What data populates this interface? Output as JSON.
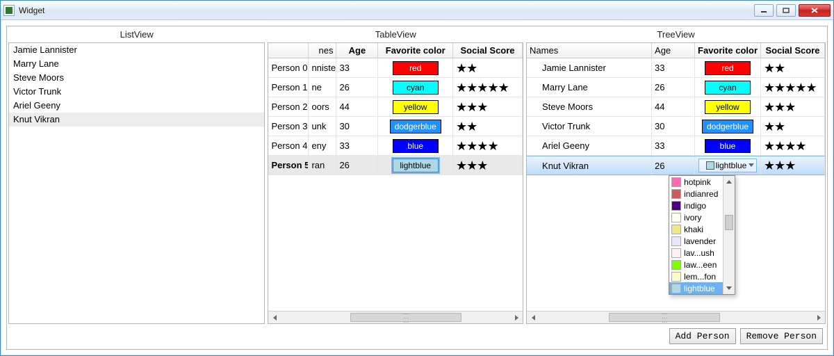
{
  "window": {
    "title": "Widget"
  },
  "listview": {
    "header": "ListView",
    "items": [
      {
        "name": "Jamie Lannister"
      },
      {
        "name": "Marry Lane"
      },
      {
        "name": "Steve Moors"
      },
      {
        "name": "Victor Trunk"
      },
      {
        "name": "Ariel Geeny"
      },
      {
        "name": "Knut Vikran",
        "selected": true
      }
    ]
  },
  "tableview": {
    "header": "TableView",
    "columns": {
      "names_partial": "nes",
      "age": "Age",
      "favorite": "Favorite color",
      "social": "Social Score"
    },
    "rows": [
      {
        "idx": "Person 0",
        "name_partial": "nnister",
        "age": "33",
        "color": "red",
        "color_hex": "#ff0000",
        "stars": 2
      },
      {
        "idx": "Person 1",
        "name_partial": "ne",
        "age": "26",
        "color": "cyan",
        "color_hex": "#00ffff",
        "stars": 5
      },
      {
        "idx": "Person 2",
        "name_partial": "oors",
        "age": "44",
        "color": "yellow",
        "color_hex": "#ffff00",
        "stars": 3
      },
      {
        "idx": "Person 3",
        "name_partial": "unk",
        "age": "30",
        "color": "dodgerblue",
        "color_hex": "#1e90ff",
        "stars": 2
      },
      {
        "idx": "Person 4",
        "name_partial": "eny",
        "age": "33",
        "color": "blue",
        "color_hex": "#0000ff",
        "stars": 4
      },
      {
        "idx": "Person 5",
        "name_partial": "ran",
        "age": "26",
        "color": "lightblue",
        "color_hex": "#add8e6",
        "stars": 3,
        "selected": true
      }
    ]
  },
  "treeview": {
    "header": "TreeView",
    "columns": {
      "names": "Names",
      "age": "Age",
      "favorite": "Favorite color",
      "social": "Social Score"
    },
    "rows": [
      {
        "name": "Jamie Lannister",
        "age": "33",
        "color": "red",
        "color_hex": "#ff0000",
        "stars": 2
      },
      {
        "name": "Marry Lane",
        "age": "26",
        "color": "cyan",
        "color_hex": "#00ffff",
        "stars": 5
      },
      {
        "name": "Steve Moors",
        "age": "44",
        "color": "yellow",
        "color_hex": "#ffff00",
        "stars": 3
      },
      {
        "name": "Victor Trunk",
        "age": "30",
        "color": "dodgerblue",
        "color_hex": "#1e90ff",
        "stars": 2
      },
      {
        "name": "Ariel Geeny",
        "age": "33",
        "color": "blue",
        "color_hex": "#0000ff",
        "stars": 4
      },
      {
        "name": "Knut Vikran",
        "age": "26",
        "color": "lightblue",
        "color_hex": "#add8e6",
        "stars": 3,
        "selected": true,
        "editing": true
      }
    ],
    "dropdown": {
      "visible_options": [
        {
          "label": "hotpink",
          "hex": "#ff69b4"
        },
        {
          "label": "indianred",
          "hex": "#cd5c5c"
        },
        {
          "label": "indigo",
          "hex": "#4b0082"
        },
        {
          "label": "ivory",
          "hex": "#fffff0"
        },
        {
          "label": "khaki",
          "hex": "#f0e68c"
        },
        {
          "label": "lavender",
          "hex": "#e6e6fa"
        },
        {
          "label": "lav...ush",
          "hex": "#fff0f5"
        },
        {
          "label": "law...een",
          "hex": "#7cfc00"
        },
        {
          "label": "lem...fon",
          "hex": "#fffacd"
        },
        {
          "label": "lightblue",
          "hex": "#add8e6",
          "selected": true
        }
      ]
    }
  },
  "buttons": {
    "add": "Add Person",
    "remove": "Remove Person"
  }
}
